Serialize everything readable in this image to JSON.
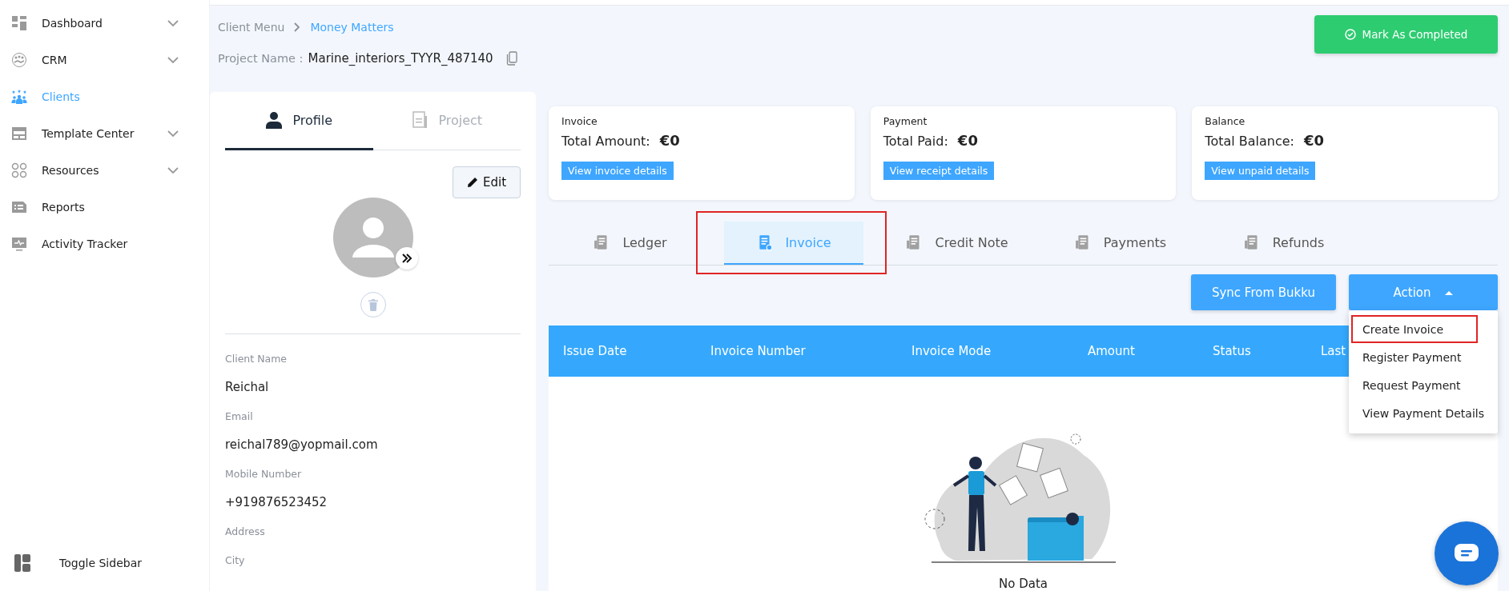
{
  "sidebar": {
    "items": [
      {
        "label": "Dashboard",
        "selected": false,
        "expandable": true
      },
      {
        "label": "CRM",
        "selected": false,
        "expandable": true
      },
      {
        "label": "Clients",
        "selected": true,
        "expandable": false
      },
      {
        "label": "Template Center",
        "selected": false,
        "expandable": true
      },
      {
        "label": "Resources",
        "selected": false,
        "expandable": true
      },
      {
        "label": "Reports",
        "selected": false,
        "expandable": false
      },
      {
        "label": "Activity Tracker",
        "selected": false,
        "expandable": false
      }
    ],
    "toggle": "Toggle Sidebar"
  },
  "breadcrumb": [
    {
      "label": "Client Menu",
      "current": false
    },
    {
      "label": "Money Matters",
      "current": true
    }
  ],
  "project": {
    "label": "Project Name :",
    "value": "Marine_interiors_TYYR_487140"
  },
  "mark_button": "Mark As Completed",
  "profile_panel": {
    "tabs": [
      {
        "label": "Profile",
        "selected": true
      },
      {
        "label": "Project",
        "selected": false
      }
    ],
    "edit_button": "Edit",
    "fields": [
      {
        "label": "Client Name",
        "value": "Reichal"
      },
      {
        "label": "Email",
        "value": "reichal789@yopmail.com"
      },
      {
        "label": "Mobile Number",
        "value": "+919876523452"
      },
      {
        "label": "Address"
      },
      {
        "label": "City"
      }
    ]
  },
  "summary_cards": [
    {
      "title": "Invoice",
      "total_label": "Total Amount:",
      "total_value": "€0",
      "button": "View invoice details"
    },
    {
      "title": "Payment",
      "total_label": "Total Paid:",
      "total_value": "€0",
      "button": "View receipt details"
    },
    {
      "title": "Balance",
      "total_label": "Total Balance:",
      "total_value": "€0",
      "button": "View unpaid details"
    }
  ],
  "ledger_tabs": [
    {
      "label": "Ledger",
      "selected": false,
      "highlighted": false
    },
    {
      "label": "Invoice",
      "selected": true,
      "highlighted": true
    },
    {
      "label": "Credit Note",
      "selected": false,
      "highlighted": false
    },
    {
      "label": "Payments",
      "selected": false,
      "highlighted": false
    },
    {
      "label": "Refunds",
      "selected": false,
      "highlighted": false
    }
  ],
  "sync_button": "Sync From Bukku",
  "action_button": "Action",
  "action_menu": [
    {
      "label": "Create Invoice",
      "highlighted": true
    },
    {
      "label": "Register Payment",
      "highlighted": false
    },
    {
      "label": "Request Payment",
      "highlighted": false
    },
    {
      "label": "View Payment Details",
      "highlighted": false
    }
  ],
  "table": {
    "columns": [
      "Issue Date",
      "Invoice Number",
      "Invoice Mode",
      "Amount",
      "Status",
      "Last"
    ],
    "empty_text": "No Data"
  }
}
